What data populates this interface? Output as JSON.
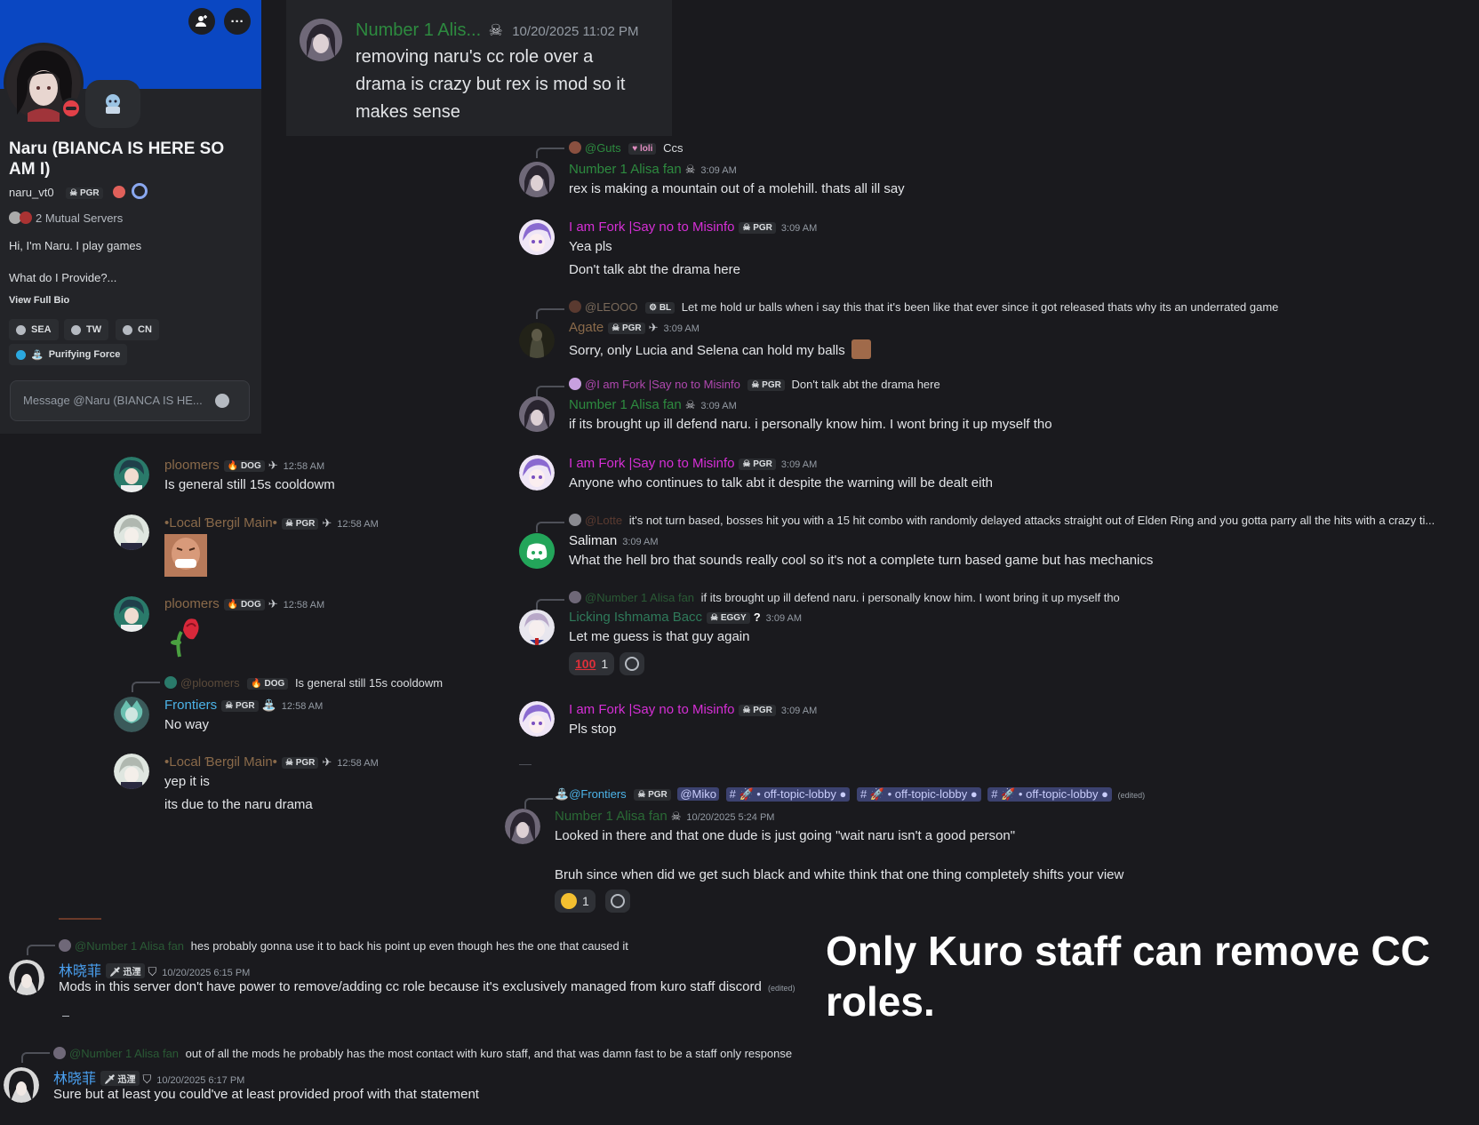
{
  "colors": {
    "green_name": "#2d8a3f",
    "pink_name": "#d62fd6",
    "brown_name": "#8a6a4a",
    "cyan_name": "#4cb3e8",
    "teal_name": "#2f7a5a",
    "blue_name": "#4aa0f0",
    "profile_banner": "#0a47c2"
  },
  "profile": {
    "display_name": "Naru (BIANCA IS HERE SO AM I)",
    "username": "naru_vt0",
    "tag": "PGR",
    "mutual_servers": "2 Mutual Servers",
    "bio_line1": "Hi, I'm Naru. I play games",
    "bio_line2": "What do I Provide?...",
    "view_bio": "View Full Bio",
    "roles": [
      "SEA",
      "TW",
      "CN"
    ],
    "role_special": "Purifying Force",
    "message_placeholder": "Message @Naru (BIANCA IS HE..."
  },
  "top_message": {
    "user": "Number 1 Alis...",
    "timestamp": "10/20/2025 11:02 PM",
    "text_l1": "removing naru's cc role over a",
    "text_l2": "drama is crazy but rex is mod so it",
    "text_l3": "makes sense"
  },
  "right_chat": {
    "m1": {
      "reply_user": "@Guts",
      "reply_tag": "loli",
      "reply_text": "Ccs",
      "user": "Number 1 Alisa fan",
      "ts": "3:09 AM",
      "text": "rex is making a mountain out of a molehill. thats all ill say"
    },
    "m2": {
      "user": "I am Fork |Say no to Misinfo",
      "tag": "PGR",
      "ts": "3:09 AM",
      "text1": "Yea pls",
      "text2": "Don't talk abt the drama here"
    },
    "m3": {
      "reply_user": "@LEOOO",
      "reply_tag": "BL",
      "reply_text": "Let me hold ur balls when i say this that it's been like that ever since it got released thats why its an underrated game",
      "user": "Agate",
      "tag": "PGR",
      "ts": "3:09 AM",
      "text": "Sorry, only Lucia and Selena can hold my balls"
    },
    "m4": {
      "reply_user": "@I am Fork |Say no to Misinfo",
      "reply_tag": "PGR",
      "reply_text": "Don't talk abt the drama here",
      "user": "Number 1 Alisa fan",
      "ts": "3:09 AM",
      "text": "if its brought up ill defend naru. i personally know him. I wont bring it up myself tho"
    },
    "m5": {
      "user": "I am Fork |Say no to Misinfo",
      "tag": "PGR",
      "ts": "3:09 AM",
      "text": "Anyone who continues to talk abt it despite the warning will be dealt eith"
    },
    "m6": {
      "reply_user": "@Lotte",
      "reply_text": "it's not turn based, bosses hit you with a 15 hit combo with randomly delayed attacks straight out of Elden Ring and you gotta parry all the hits with a crazy ti...",
      "user": "Saliman",
      "ts": "3:09 AM",
      "text": "What the hell bro that sounds really cool so it's not a complete turn based game but has mechanics"
    },
    "m7": {
      "reply_user": "@Number 1 Alisa fan",
      "reply_text": "if its brought up ill defend naru. i personally know him. I wont bring it up myself tho",
      "user": "Licking Ishmama Bacc",
      "tag": "EGGY",
      "ts": "3:09 AM",
      "text": "Let me guess is that guy again",
      "reaction_count": "1"
    },
    "m8": {
      "user": "I am Fork |Say no to Misinfo",
      "tag": "PGR",
      "ts": "3:09 AM",
      "text": "Pls stop"
    }
  },
  "left_chat": {
    "m1": {
      "user": "ploomers",
      "tag": "DOG",
      "ts": "12:58 AM",
      "text": "Is general still 15s cooldowm"
    },
    "m2": {
      "user": "•Local Ɓergil Main•",
      "tag": "PGR",
      "ts": "12:58 AM"
    },
    "m3": {
      "user": "ploomers",
      "tag": "DOG",
      "ts": "12:58 AM"
    },
    "m4": {
      "reply_user": "@ploomers",
      "reply_tag": "DOG",
      "reply_text": "Is general still 15s cooldowm",
      "user": "Frontiers",
      "tag": "PGR",
      "ts": "12:58 AM",
      "text": "No way"
    },
    "m5": {
      "user": "•Local Ɓergil Main•",
      "tag": "PGR",
      "ts": "12:58 AM",
      "text1": "yep it is",
      "text2": "its due to the naru drama"
    }
  },
  "mid_message": {
    "reply_user": "@Frontiers",
    "reply_tag": "PGR",
    "reply_mention": "@Miko",
    "channel": "off-topic-lobby",
    "edited": "(edited)",
    "user": "Number 1 Alisa fan",
    "ts": "10/20/2025 5:24 PM",
    "text1": "Looked in there and that one dude is just going \"wait naru isn't a good person\"",
    "text2": "Bruh since when did we get such black and white think that one thing completely shifts your view",
    "reaction_count": "1"
  },
  "bottom": {
    "b1": {
      "reply_user": "@Number 1 Alisa fan",
      "reply_text": "hes probably gonna use it to back his point up even though hes the one that caused it",
      "user": "林晓菲",
      "tag": "迅湮",
      "ts": "10/20/2025 6:15 PM",
      "text": "Mods in this server don't have power to remove/adding cc role because it's exclusively managed from kuro staff discord",
      "edited": "(edited)"
    },
    "b2": {
      "reply_user": "@Number 1 Alisa fan",
      "reply_text": "out of all the mods he probably has the most contact with kuro staff, and that was damn fast to be a staff only response",
      "user": "林晓菲",
      "tag": "迅湮",
      "ts": "10/20/2025 6:17 PM",
      "text": "Sure but at least you could've at least provided proof with that  statement"
    }
  },
  "caption": {
    "line1": "Only Kuro staff can remove CC",
    "line2": "roles."
  }
}
